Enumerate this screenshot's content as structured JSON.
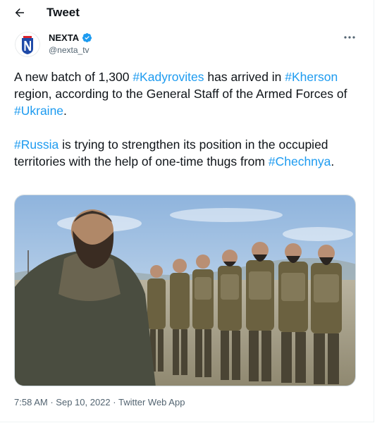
{
  "header": {
    "title": "Tweet",
    "back_icon": "arrow-left-icon"
  },
  "author": {
    "name": "NEXTA",
    "handle": "@nexta_tv",
    "verified": true,
    "avatar_letter": "N",
    "brand_colors": {
      "blue": "#1f4aa8",
      "red": "#d9232e"
    }
  },
  "tweet": {
    "paragraphs": [
      [
        {
          "text": "A new batch of 1,300 ",
          "tag": false
        },
        {
          "text": "#Kadyrovites",
          "tag": true
        },
        {
          "text": " has arrived in ",
          "tag": false
        },
        {
          "text": "#Kherson",
          "tag": true
        },
        {
          "text": " region, according to the General Staff of the Armed Forces of ",
          "tag": false
        },
        {
          "text": "#Ukraine",
          "tag": true
        },
        {
          "text": ".",
          "tag": false
        }
      ],
      [
        {
          "text": "#Russia",
          "tag": true
        },
        {
          "text": " is trying to strengthen its position in the occupied territories with the help of one-time thugs from ",
          "tag": false
        },
        {
          "text": "#Chechnya",
          "tag": true
        },
        {
          "text": ".",
          "tag": false
        }
      ]
    ]
  },
  "meta": {
    "time": "7:58 AM",
    "separator": "·",
    "date": "Sep 10, 2022",
    "source": "Twitter Web App"
  },
  "colors": {
    "link": "#1d9bf0",
    "text": "#0f1419",
    "secondary": "#536471",
    "verified": "#1d9bf0"
  }
}
